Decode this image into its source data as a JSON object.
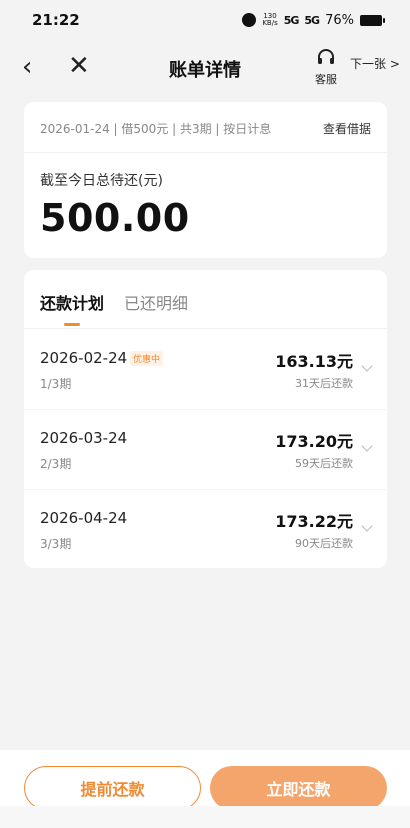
{
  "status_bar": {
    "time": "21:22",
    "net_speed_value": "130",
    "net_speed_unit": "KB/s",
    "signal_1": "5G",
    "signal_2": "5G",
    "battery": "76%"
  },
  "nav": {
    "title": "账单详情",
    "service_label": "客服",
    "next_label": "下一张 >"
  },
  "summary": {
    "loan_info": "2026-01-24 | 借500元 | 共3期 | 按日计息",
    "view_loan_label": "查看借据",
    "total_label": "截至今日总待还(元)",
    "total_amount": "500.00"
  },
  "tabs": [
    {
      "label": "还款计划",
      "active": true
    },
    {
      "label": "已还明细",
      "active": false
    }
  ],
  "installments": [
    {
      "date": "2026-02-24",
      "badge": "优惠中",
      "period": "1/3期",
      "amount": "163.13元",
      "due": "31天后还款"
    },
    {
      "date": "2026-03-24",
      "badge": "",
      "period": "2/3期",
      "amount": "173.20元",
      "due": "59天后还款"
    },
    {
      "date": "2026-04-24",
      "badge": "",
      "period": "3/3期",
      "amount": "173.22元",
      "due": "90天后还款"
    }
  ],
  "actions": {
    "prepay_label": "提前还款",
    "pay_now_label": "立即还款"
  },
  "colors": {
    "accent": "#f08a33",
    "primary_button": "#f4a56c",
    "background": "#f3f3f3"
  }
}
